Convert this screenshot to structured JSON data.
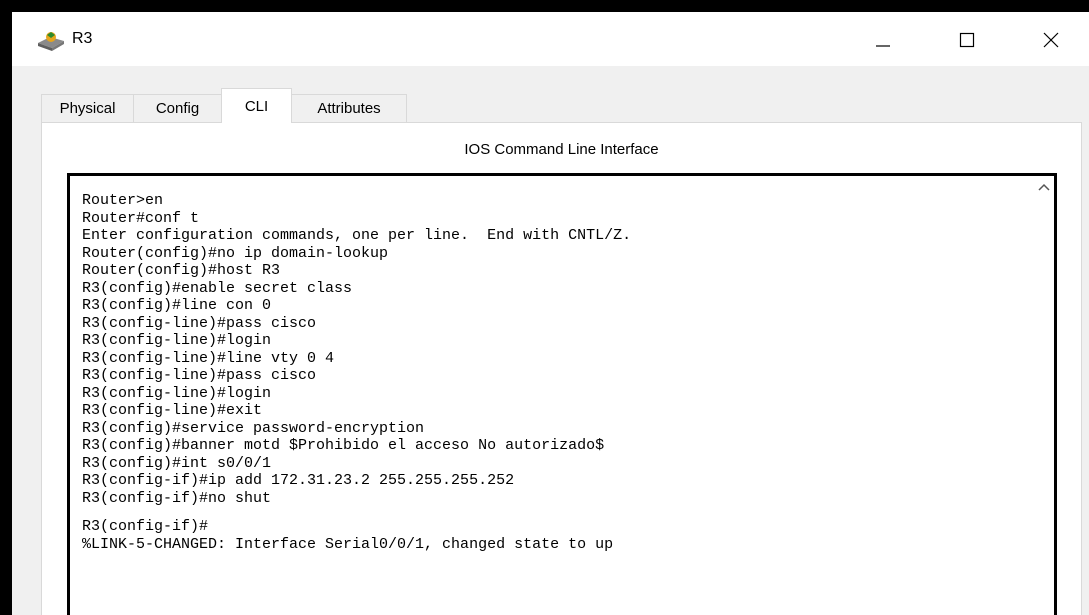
{
  "window": {
    "title": "R3",
    "app_icon": "packet-tracer-router-icon"
  },
  "tabs": [
    {
      "label": "Physical",
      "active": false
    },
    {
      "label": "Config",
      "active": false
    },
    {
      "label": "CLI",
      "active": true
    },
    {
      "label": "Attributes",
      "active": false
    }
  ],
  "panel": {
    "heading": "IOS Command Line Interface"
  },
  "terminal": {
    "lines": [
      "Router>en",
      "Router#conf t",
      "Enter configuration commands, one per line.  End with CNTL/Z.",
      "Router(config)#no ip domain-lookup",
      "Router(config)#host R3",
      "R3(config)#enable secret class",
      "R3(config)#line con 0",
      "R3(config-line)#pass cisco",
      "R3(config-line)#login",
      "R3(config-line)#line vty 0 4",
      "R3(config-line)#pass cisco",
      "R3(config-line)#login",
      "R3(config-line)#exit",
      "R3(config)#service password-encryption",
      "R3(config)#banner motd $Prohibido el acceso No autorizado$",
      "R3(config)#int s0/0/1",
      "R3(config-if)#ip add 172.31.23.2 255.255.255.252",
      "R3(config-if)#no shut",
      "R3(config-if)#",
      "%LINK-5-CHANGED: Interface Serial0/0/1, changed state to up"
    ]
  }
}
